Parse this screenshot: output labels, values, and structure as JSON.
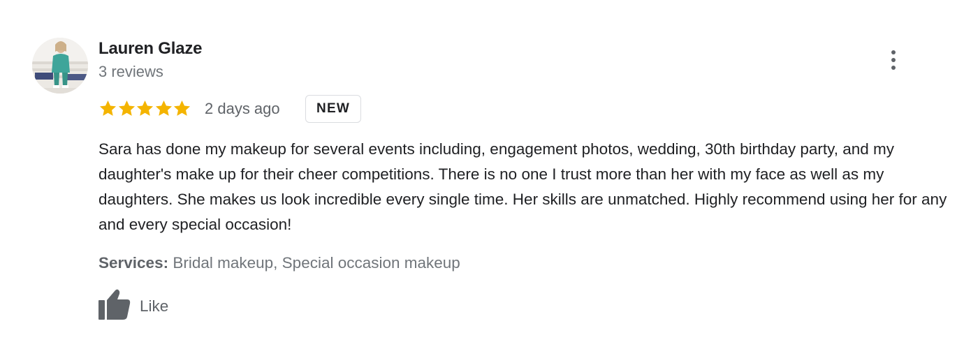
{
  "review": {
    "reviewer_name": "Lauren Glaze",
    "review_count": "3 reviews",
    "rating": 5,
    "rating_max": 5,
    "date": "2 days ago",
    "badge": "NEW",
    "text": "Sara has done my makeup for several events including, engagement photos, wedding, 30th birthday party, and my daughter's make up for their cheer competitions. There is no one I trust more than her with my face as well as my daughters. She makes us look incredible every single time. Her skills are unmatched. Highly recommend using her for any and every special occasion!",
    "services_label": "Services:",
    "services_value": "Bridal makeup, Special occasion makeup",
    "like_label": "Like"
  },
  "icons": {
    "avatar": "reviewer-photo",
    "more": "more-vert-icon",
    "star": "star-icon",
    "like": "thumb-up-icon"
  },
  "colors": {
    "star": "#f4b400",
    "primary_text": "#202124",
    "secondary_text": "#70757a",
    "badge_border": "#dadce0"
  }
}
